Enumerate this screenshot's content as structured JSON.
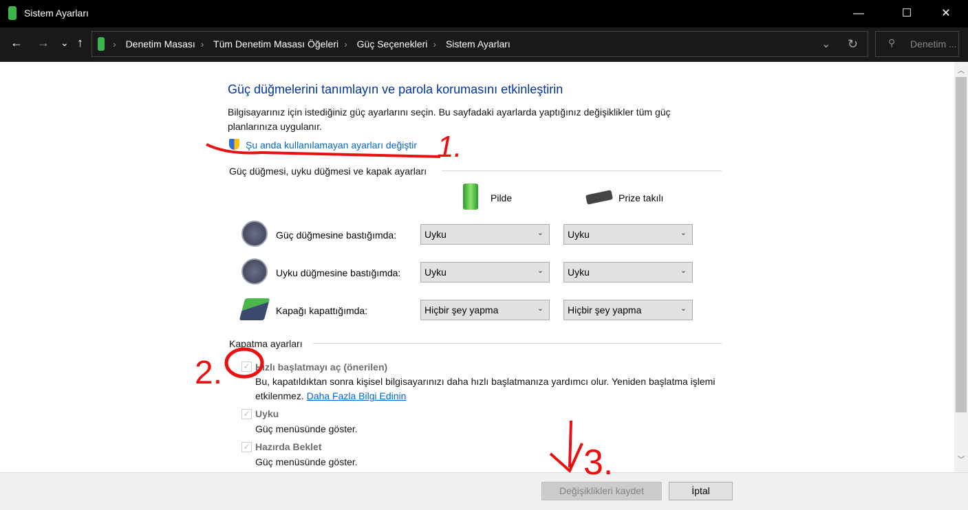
{
  "window": {
    "title": "Sistem Ayarları",
    "minimize": "—",
    "maximize": "☐",
    "close": "✕"
  },
  "nav": {
    "back": "←",
    "forward": "→",
    "recent": "⌄",
    "up": "↑",
    "breadcrumbs": [
      "Denetim Masası",
      "Tüm Denetim Masası Öğeleri",
      "Güç Seçenekleri",
      "Sistem Ayarları"
    ],
    "search_placeholder": "Denetim ...",
    "refresh": "↻",
    "dropdown": "⌄"
  },
  "page": {
    "heading": "Güç düğmelerini tanımlayın ve parola korumasını etkinleştirin",
    "intro": "Bilgisayarınız için istediğiniz güç ayarlarını seçin. Bu sayfadaki ayarlarda yaptığınız değişiklikler tüm güç planlarınıza uygulanır.",
    "change_link": "Şu anda kullanılamayan ayarları değiştir",
    "group1": "Güç düğmesi, uyku düğmesi ve kapak ayarları",
    "col_battery": "Pilde",
    "col_plugged": "Prize takılı",
    "rows": [
      {
        "label": "Güç düğmesine bastığımda:",
        "battery": "Uyku",
        "plugged": "Uyku"
      },
      {
        "label": "Uyku düğmesine bastığımda:",
        "battery": "Uyku",
        "plugged": "Uyku"
      },
      {
        "label": "Kapağı kapattığımda:",
        "battery": "Hiçbir şey yapma",
        "plugged": "Hiçbir şey yapma"
      }
    ],
    "group2": "Kapatma ayarları",
    "fast_startup": {
      "label": "Hızlı başlatmayı aç (önerilen)",
      "checked": true,
      "desc": "Bu, kapatıldıktan sonra kişisel bilgisayarınızı daha hızlı başlatmanıza yardımcı olur. Yeniden başlatma işlemi etkilenmez.",
      "link": "Daha Fazla Bilgi Edinin"
    },
    "sleep": {
      "label": "Uyku",
      "checked": true,
      "desc": "Güç menüsünde göster."
    },
    "hibernate": {
      "label": "Hazırda Beklet",
      "checked": true,
      "desc": "Güç menüsünde göster."
    }
  },
  "footer": {
    "save": "Değişiklikleri kaydet",
    "cancel": "İptal"
  },
  "annotations": {
    "color": "#e81010",
    "one": "1.",
    "two": "2.",
    "three": "3."
  }
}
